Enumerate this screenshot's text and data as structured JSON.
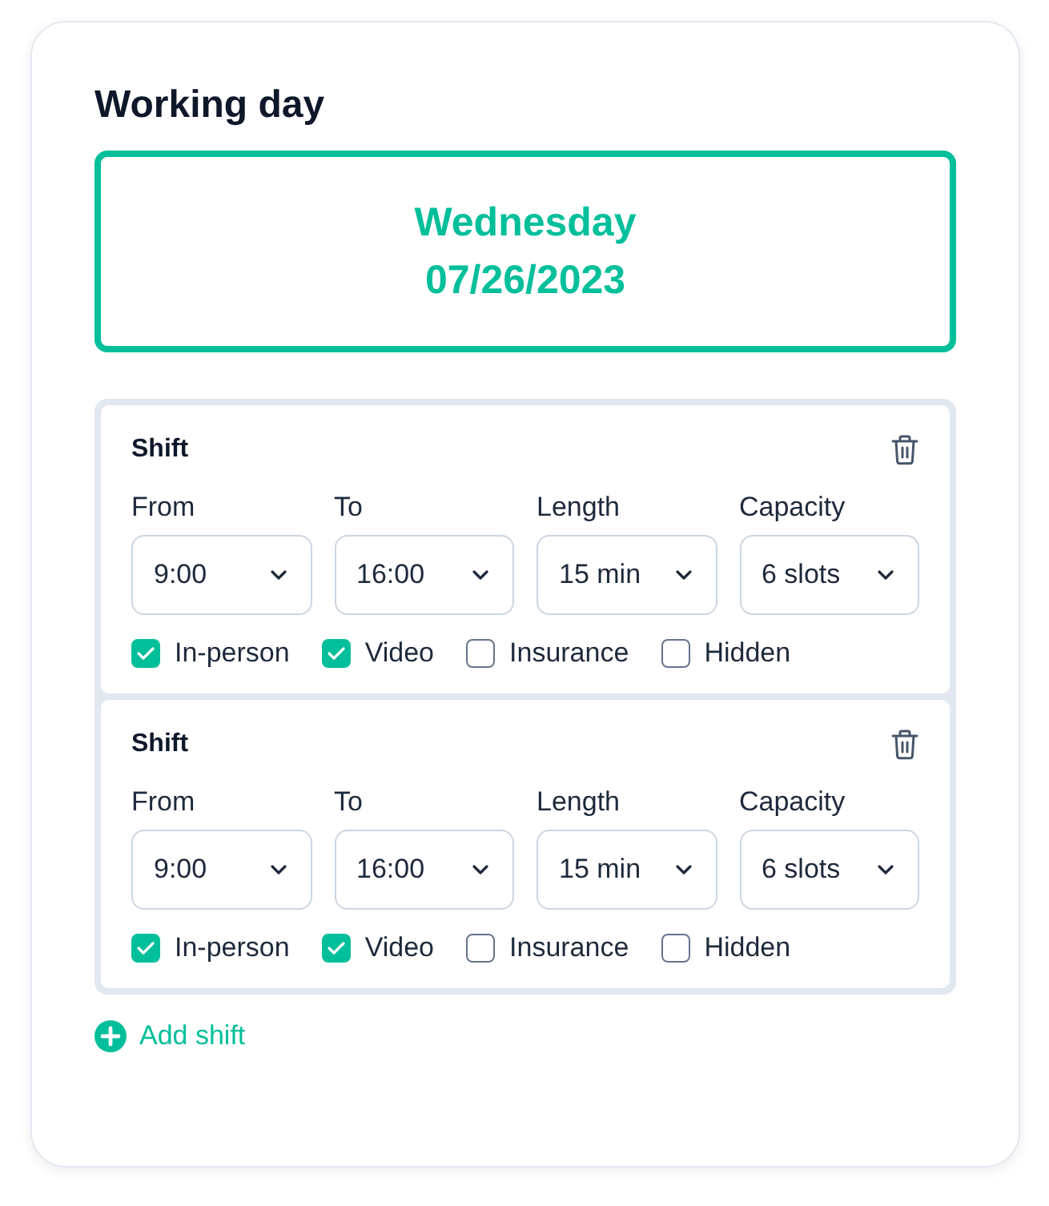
{
  "title": "Working day",
  "date": {
    "weekday": "Wednesday",
    "date": "07/26/2023"
  },
  "shifts": [
    {
      "title": "Shift",
      "fields": [
        {
          "label": "From",
          "value": "9:00"
        },
        {
          "label": "To",
          "value": "16:00"
        },
        {
          "label": "Length",
          "value": "15 min"
        },
        {
          "label": "Capacity",
          "value": "6 slots"
        }
      ],
      "options": [
        {
          "label": "In-person",
          "checked": true
        },
        {
          "label": "Video",
          "checked": true
        },
        {
          "label": "Insurance",
          "checked": false
        },
        {
          "label": "Hidden",
          "checked": false
        }
      ]
    },
    {
      "title": "Shift",
      "fields": [
        {
          "label": "From",
          "value": "9:00"
        },
        {
          "label": "To",
          "value": "16:00"
        },
        {
          "label": "Length",
          "value": "15 min"
        },
        {
          "label": "Capacity",
          "value": "6 slots"
        }
      ],
      "options": [
        {
          "label": "In-person",
          "checked": true
        },
        {
          "label": "Video",
          "checked": true
        },
        {
          "label": "Insurance",
          "checked": false
        },
        {
          "label": "Hidden",
          "checked": false
        }
      ]
    }
  ],
  "add_button": "Add shift"
}
